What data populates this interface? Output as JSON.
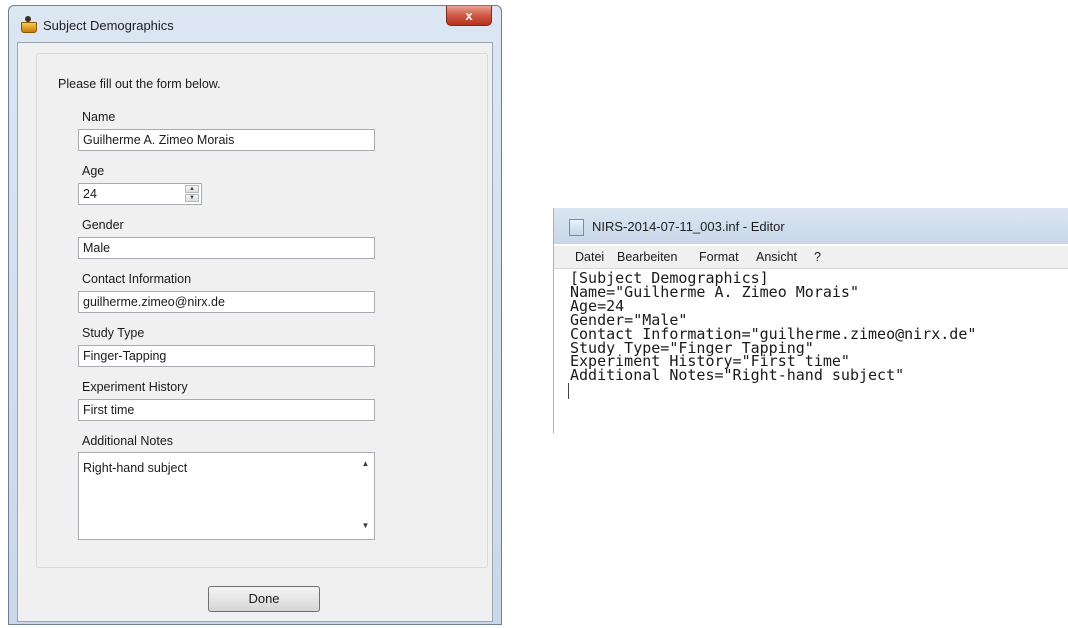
{
  "dialog": {
    "title": "Subject Demographics",
    "close_label": "x",
    "intro": "Please fill out the form below.",
    "fields": {
      "name": {
        "label": "Name",
        "value": "Guilherme A. Zimeo Morais"
      },
      "age": {
        "label": "Age",
        "value": "24"
      },
      "gender": {
        "label": "Gender",
        "value": "Male"
      },
      "contact": {
        "label": "Contact Information",
        "value": "guilherme.zimeo@nirx.de"
      },
      "study_type": {
        "label": "Study Type",
        "value": "Finger-Tapping"
      },
      "experiment_history": {
        "label": "Experiment History",
        "value": "First time"
      },
      "notes": {
        "label": "Additional Notes",
        "value": "Right-hand subject"
      }
    },
    "done_label": "Done"
  },
  "editor": {
    "title": "NIRS-2014-07-11_003.inf - Editor",
    "menu": [
      "Datei",
      "Bearbeiten",
      "Format",
      "Ansicht",
      "?"
    ],
    "lines": [
      "[Subject Demographics]",
      "Name=\"Guilherme A. Zimeo Morais\"",
      "Age=24",
      "Gender=\"Male\"",
      "Contact Information=\"guilherme.zimeo@nirx.de\"",
      "Study Type=\"Finger Tapping\"",
      "Experiment History=\"First time\"",
      "Additional Notes=\"Right-hand subject\""
    ]
  }
}
